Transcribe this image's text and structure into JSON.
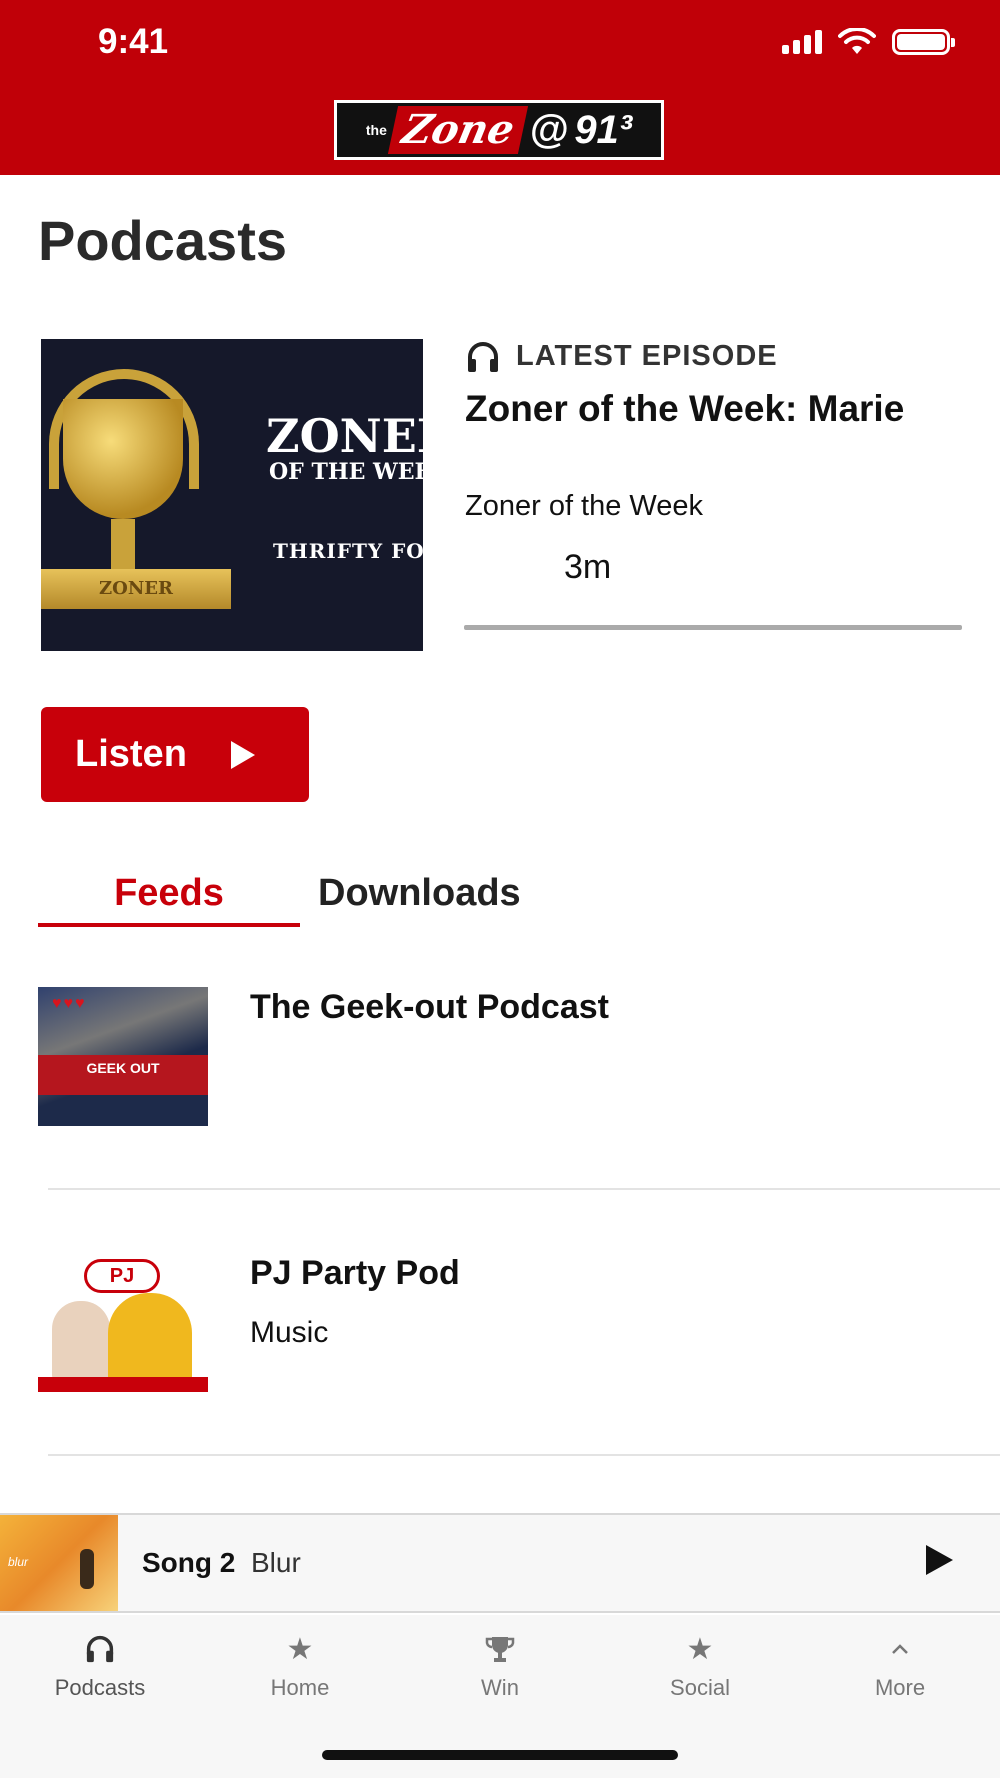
{
  "status_bar": {
    "time": "9:41"
  },
  "header": {
    "logo_the": "the",
    "logo_zone": "Zone",
    "logo_at": "@",
    "logo_freq": "91³"
  },
  "page": {
    "title": "Podcasts"
  },
  "latest": {
    "label": "LATEST EPISODE",
    "title": "Zoner of the Week: Marie",
    "show": "Zoner of the Week",
    "duration": "3m",
    "progress": 0,
    "art_title": "ZONER",
    "art_subtitle": "OF THE WEEK",
    "art_sponsor": "THRIFTY FO",
    "art_ribbon": "ZONER"
  },
  "listen_button": {
    "label": "Listen"
  },
  "tabs": [
    {
      "label": "Feeds",
      "selected": true
    },
    {
      "label": "Downloads",
      "selected": false
    }
  ],
  "feeds": [
    {
      "title": "The Geek-out Podcast",
      "subtitle": "",
      "thumb_text": "GEEK OUT"
    },
    {
      "title": "PJ Party Pod",
      "subtitle": "Music",
      "thumb_text": "PJ"
    }
  ],
  "now_playing": {
    "song": "Song 2",
    "artist": "Blur",
    "art_text": "blur"
  },
  "tab_bar": [
    {
      "label": "Podcasts",
      "icon": "headphones-icon",
      "active": true
    },
    {
      "label": "Home",
      "icon": "star-icon",
      "active": false
    },
    {
      "label": "Win",
      "icon": "trophy-icon",
      "active": false
    },
    {
      "label": "Social",
      "icon": "star-icon",
      "active": false
    },
    {
      "label": "More",
      "icon": "chevron-up-icon",
      "active": false
    }
  ],
  "colors": {
    "brand_red": "#c00008",
    "accent_red": "#c8000a",
    "text": "#111111",
    "muted": "#777777"
  }
}
